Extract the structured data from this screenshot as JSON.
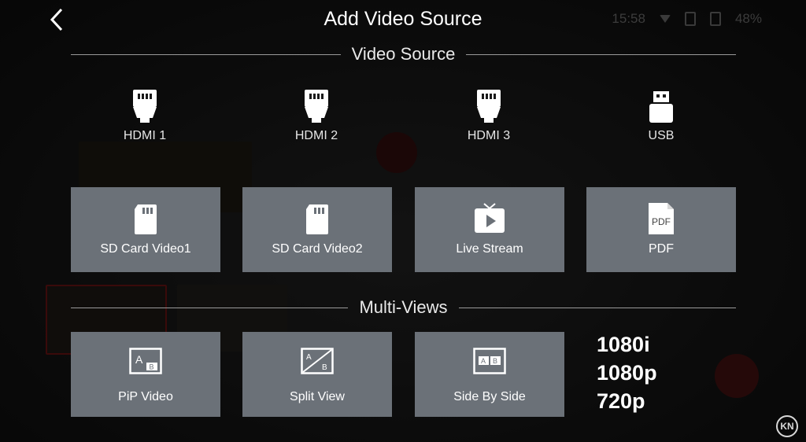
{
  "header": {
    "title": "Add Video Source"
  },
  "status_bar": {
    "time": "15:58",
    "battery": "48%"
  },
  "video_source": {
    "section_label": "Video Source",
    "inputs": [
      {
        "label": "HDMI 1",
        "icon": "hdmi-icon"
      },
      {
        "label": "HDMI 2",
        "icon": "hdmi-icon"
      },
      {
        "label": "HDMI 3",
        "icon": "hdmi-icon"
      },
      {
        "label": "USB",
        "icon": "usb-icon"
      }
    ],
    "tiles": [
      {
        "label": "SD Card Video1",
        "icon": "sd-card-icon"
      },
      {
        "label": "SD Card Video2",
        "icon": "sd-card-icon"
      },
      {
        "label": "Live Stream",
        "icon": "tv-icon"
      },
      {
        "label": "PDF",
        "icon": "pdf-icon",
        "icon_text": "PDF"
      }
    ]
  },
  "multi_views": {
    "section_label": "Multi-Views",
    "tiles": [
      {
        "label": "PiP Video",
        "icon": "pip-icon",
        "icon_text_a": "A",
        "icon_text_b": "B"
      },
      {
        "label": "Split View",
        "icon": "split-view-icon",
        "icon_text_a": "A",
        "icon_text_b": "B"
      },
      {
        "label": "Side By Side",
        "icon": "side-by-side-icon",
        "icon_text_a": "A",
        "icon_text_b": "B"
      }
    ]
  },
  "resolutions": [
    "1080i",
    "1080p",
    "720p"
  ],
  "watermark": {
    "text": "KN"
  },
  "colors": {
    "tile_bg": "#6b7178",
    "background": "#0f0f0f",
    "divider": "#9a9a9a",
    "text": "#ffffff"
  }
}
